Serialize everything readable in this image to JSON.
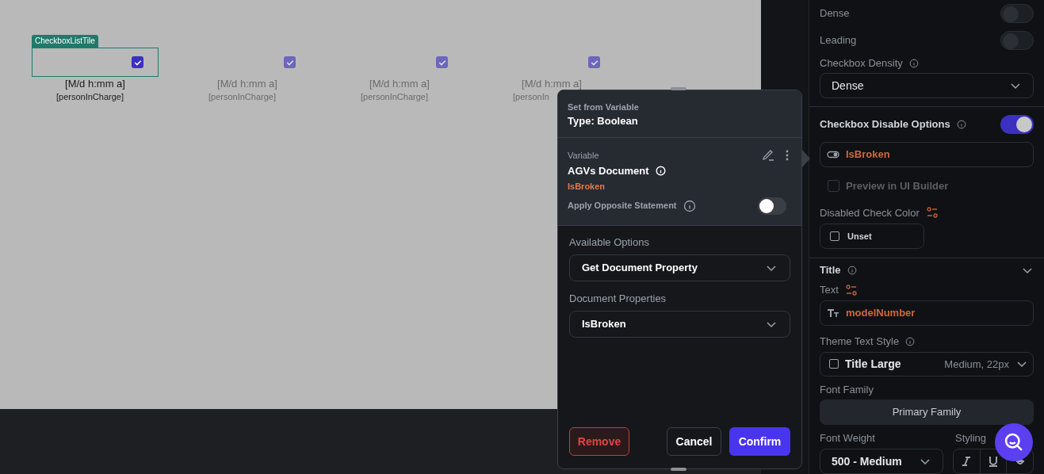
{
  "canvas": {
    "selected_label": "CheckboxListTile",
    "tiles": [
      {
        "checked": true,
        "selected": true,
        "disabled": false,
        "date": "[M/d h:mm a]",
        "person": "[personInCharge]"
      },
      {
        "checked": true,
        "selected": false,
        "disabled": true,
        "date": "[M/d h:mm a]",
        "person": "[personInCharge]"
      },
      {
        "checked": true,
        "selected": false,
        "disabled": true,
        "date": "[M/d h:mm a]",
        "person": "[personInCharge]"
      },
      {
        "checked": true,
        "selected": false,
        "disabled": true,
        "date": "[M/d h:mm a]",
        "person": "[personIn"
      }
    ]
  },
  "popup": {
    "caption": "Set from Variable",
    "title": "Type: Boolean",
    "variable": {
      "caption": "Variable",
      "name": "AGVs Document",
      "field": "IsBroken",
      "opposite_label": "Apply Opposite Statement",
      "opposite_on": false
    },
    "options": {
      "label": "Available Options",
      "value": "Get Document Property"
    },
    "properties": {
      "label": "Document Properties",
      "value": "IsBroken"
    },
    "buttons": [
      {
        "kind": "danger",
        "label": "Remove"
      },
      {
        "kind": "outline",
        "label": "Cancel"
      },
      {
        "kind": "primary",
        "label": "Confirm"
      }
    ]
  },
  "panel": {
    "toggles": [
      {
        "label": "Dense",
        "on": false
      },
      {
        "label": "Leading",
        "on": false
      }
    ],
    "density": {
      "label": "Checkbox Density",
      "value": "Dense"
    },
    "disable_options": {
      "label": "Checkbox Disable Options",
      "on": true,
      "variable": "IsBroken"
    },
    "preview": {
      "label": "Preview in UI Builder",
      "checked": false,
      "disabled": true
    },
    "disabled_color": {
      "label": "Disabled Check Color",
      "value": "Unset"
    },
    "title": {
      "label": "Title",
      "expanded": true
    },
    "text": {
      "label": "Text",
      "value": "modelNumber"
    },
    "theme_style": {
      "label": "Theme Text Style",
      "value": "Title Large",
      "detail": "Medium, 22px"
    },
    "font_family": {
      "label": "Font Family",
      "value": "Primary Family"
    },
    "font_weight": {
      "label": "Font Weight",
      "value": "500 - Medium"
    },
    "styling": {
      "label": "Styling"
    }
  }
}
